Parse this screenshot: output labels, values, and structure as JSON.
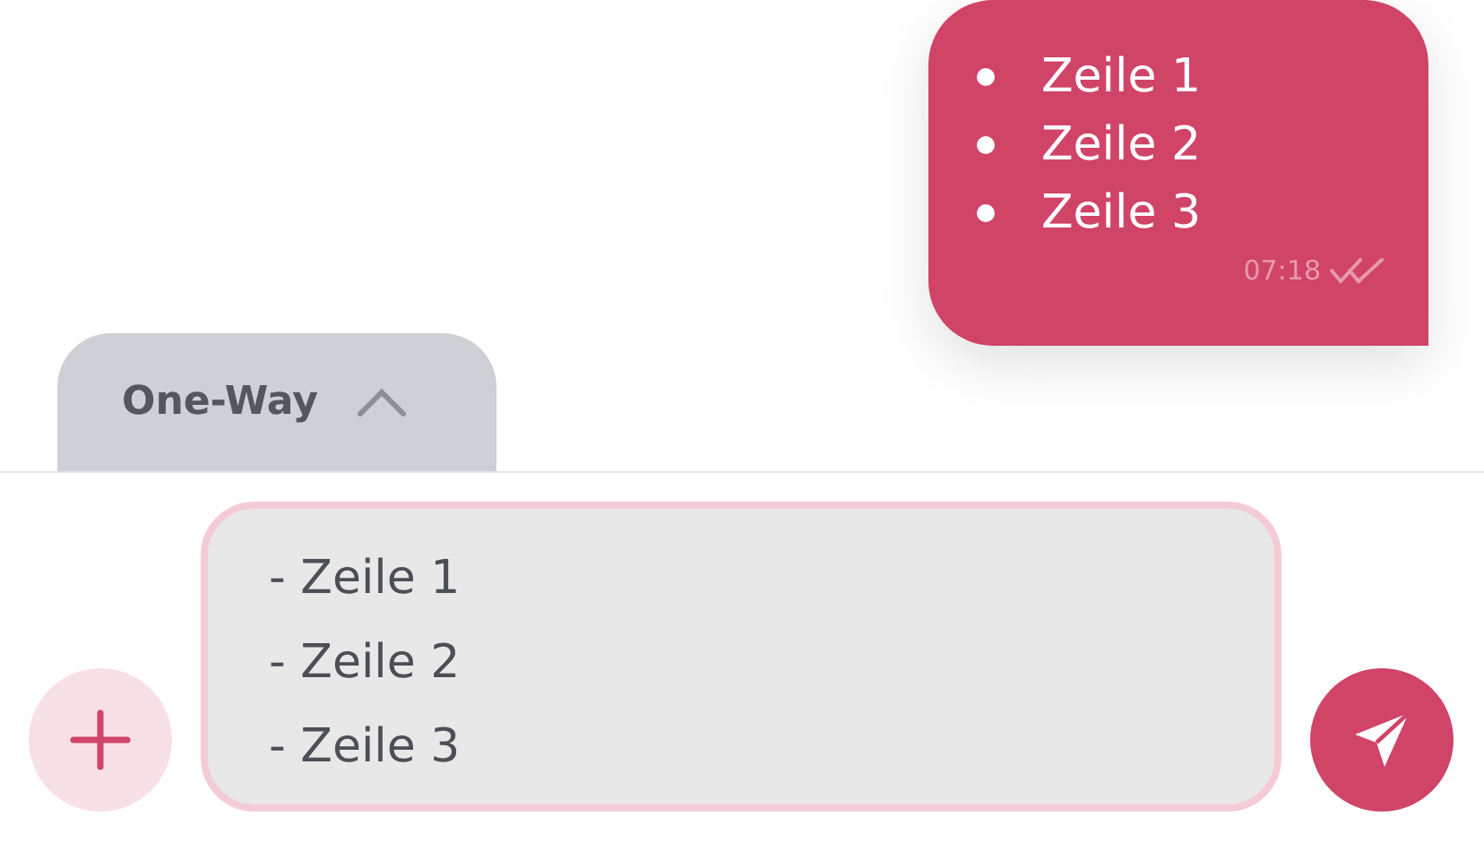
{
  "message": {
    "items": [
      "Zeile 1",
      "Zeile 2",
      "Zeile 3"
    ],
    "time": "07:18",
    "read": true
  },
  "mode_tab": {
    "label": "One-Way",
    "expanded": false
  },
  "composer": {
    "value": "- Zeile 1\n- Zeile 2\n- Zeile 3"
  }
}
